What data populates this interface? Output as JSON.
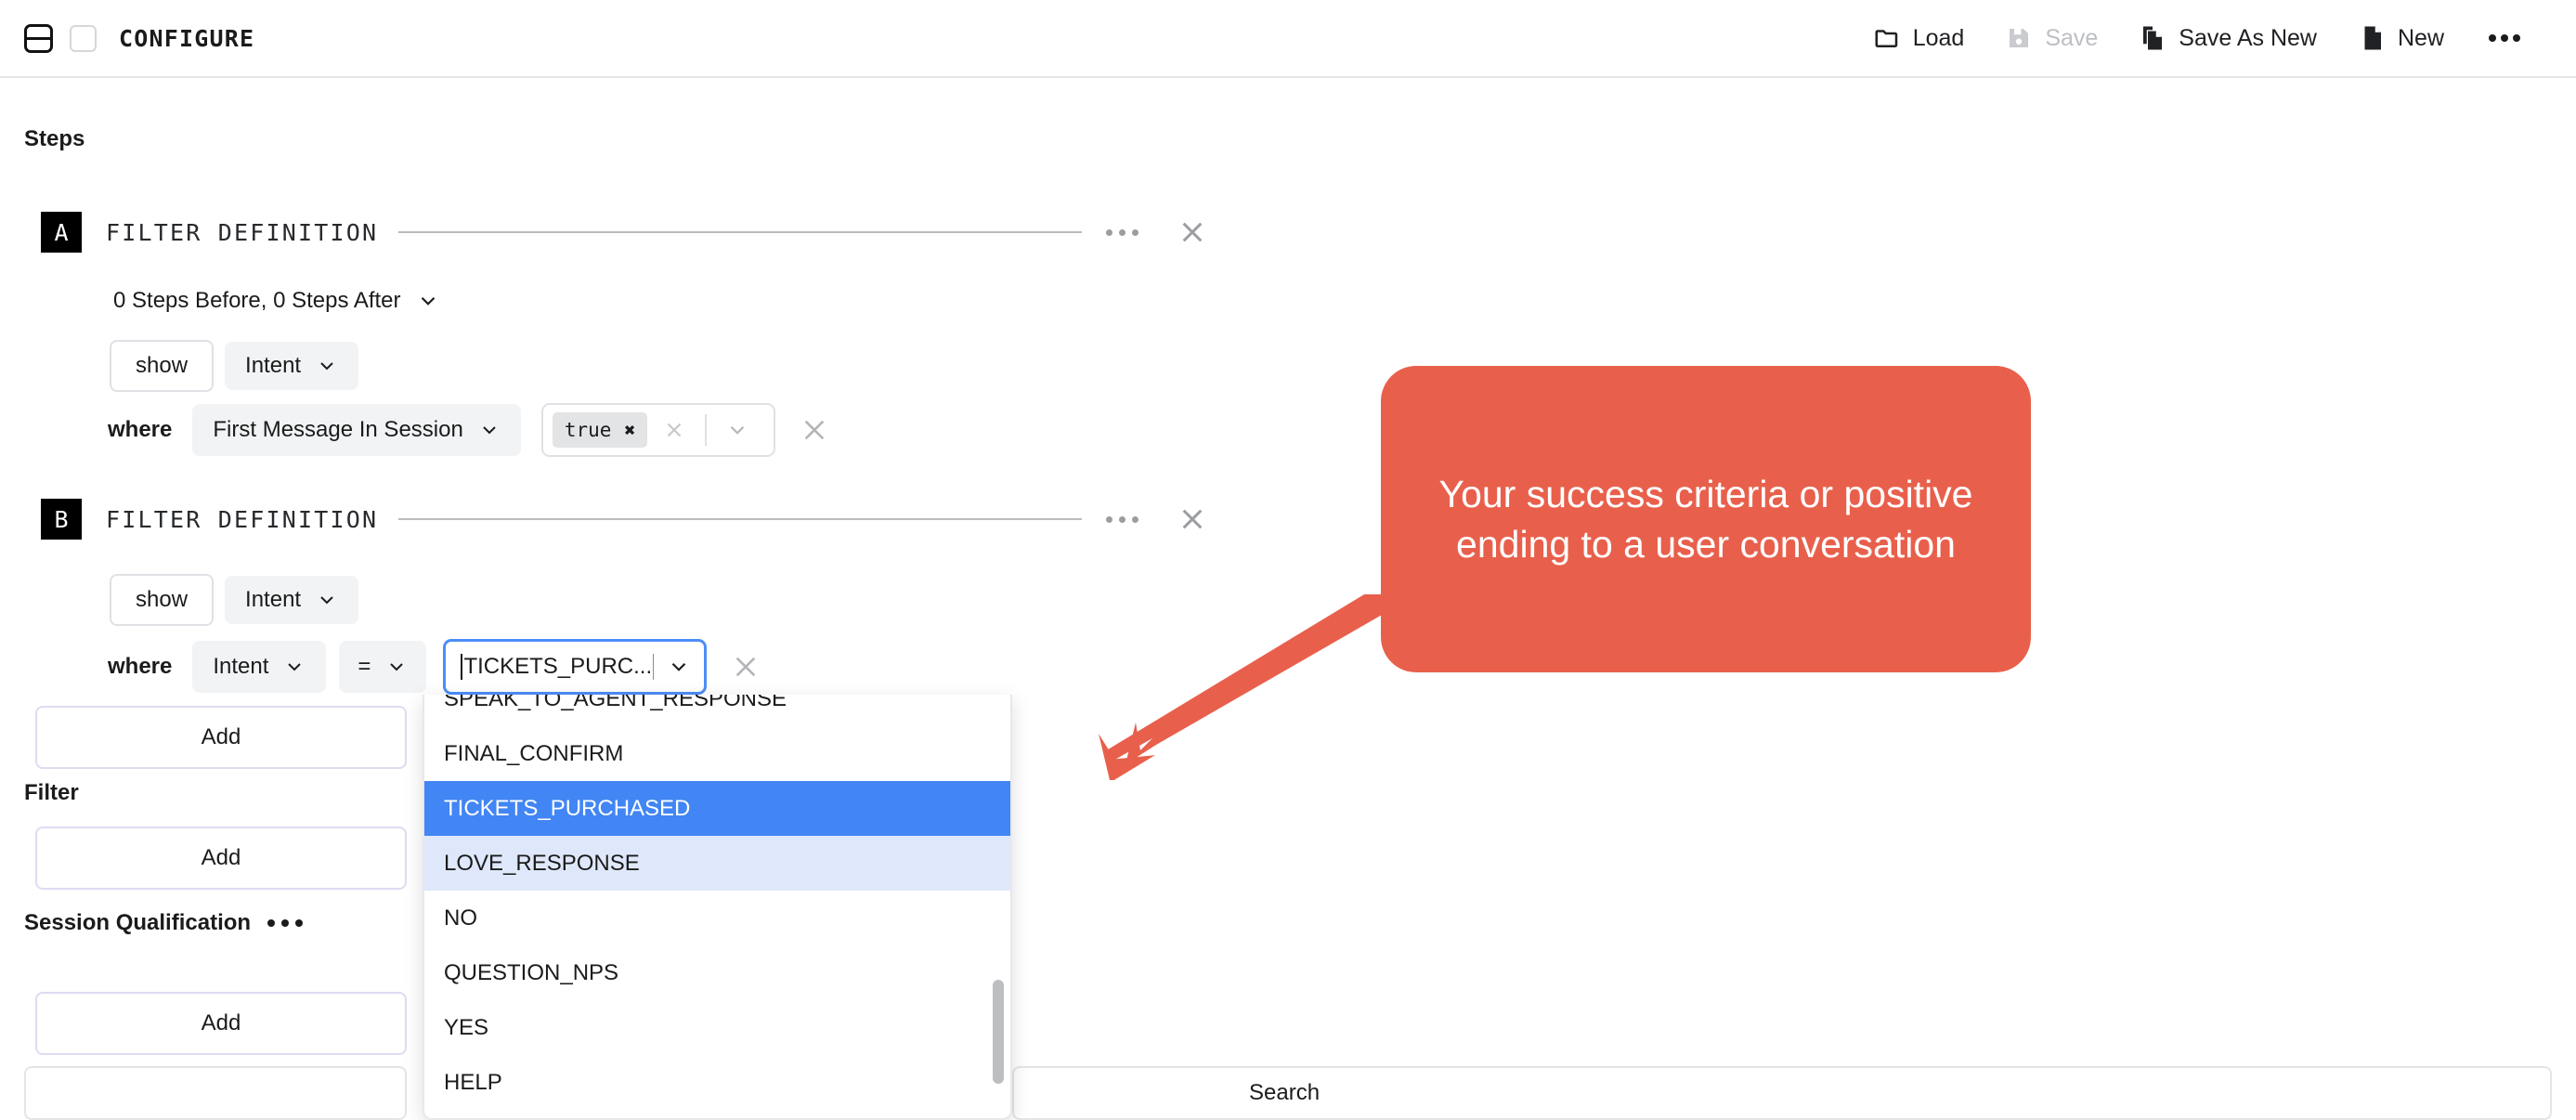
{
  "topbar": {
    "title": "CONFIGURE",
    "panel_icon": "panel-layout-icon",
    "checkbox_icon": "checkbox-icon",
    "buttons": [
      {
        "label": "Load",
        "icon": "folder-icon",
        "disabled": false
      },
      {
        "label": "Save",
        "icon": "floppy-disk-icon",
        "disabled": true
      },
      {
        "label": "Save As New",
        "icon": "copy-file-icon",
        "disabled": false
      },
      {
        "label": "New",
        "icon": "file-icon",
        "disabled": false
      }
    ],
    "overflow_icon": "more-horizontal-icon"
  },
  "steps": {
    "label": "Steps",
    "filters": [
      {
        "badge": "A",
        "title": "FILTER DEFINITION",
        "menu_icon": "more-horizontal-icon",
        "close_icon": "close-icon",
        "steps_selector": "0 Steps Before, 0 Steps After",
        "show_label": "show",
        "show_field": "Intent",
        "where_label": "where",
        "where_field": "First Message In Session",
        "value_chips": [
          {
            "text": "true",
            "remove_icon": "close-icon"
          }
        ],
        "clear_icon": "clear-icon",
        "expand_icon": "chevron-down-icon",
        "remove_icon": "close-icon"
      },
      {
        "badge": "B",
        "title": "FILTER DEFINITION",
        "menu_icon": "more-horizontal-icon",
        "close_icon": "close-icon",
        "show_label": "show",
        "show_field": "Intent",
        "where_label": "where",
        "where_field": "Intent",
        "operator": "=",
        "value_text": "TICKETS_PURC...",
        "expand_icon": "chevron-down-icon",
        "remove_icon": "close-icon"
      }
    ],
    "add_label": "Add"
  },
  "filter_section": {
    "label": "Filter",
    "add_label": "Add"
  },
  "session_section": {
    "label": "Session Qualification",
    "menu_icon": "more-horizontal-icon",
    "add_label": "Add"
  },
  "dropdown": {
    "scrollbar": "vertical-scrollbar",
    "options": [
      {
        "text": "SPEAK_TO_AGENT_RESPONSE",
        "state": "clipped"
      },
      {
        "text": "FINAL_CONFIRM",
        "state": "normal"
      },
      {
        "text": "TICKETS_PURCHASED",
        "state": "selected"
      },
      {
        "text": "LOVE_RESPONSE",
        "state": "hover"
      },
      {
        "text": "NO",
        "state": "normal"
      },
      {
        "text": "QUESTION_NPS",
        "state": "normal"
      },
      {
        "text": "YES",
        "state": "normal"
      },
      {
        "text": "HELP",
        "state": "normal"
      }
    ]
  },
  "bottom": {
    "search_label": "Search"
  },
  "callout": {
    "text": "Your success criteria or positive ending to a user conversation",
    "color": "#e8604c",
    "arrow_icon": "arrow-pointer-icon"
  }
}
